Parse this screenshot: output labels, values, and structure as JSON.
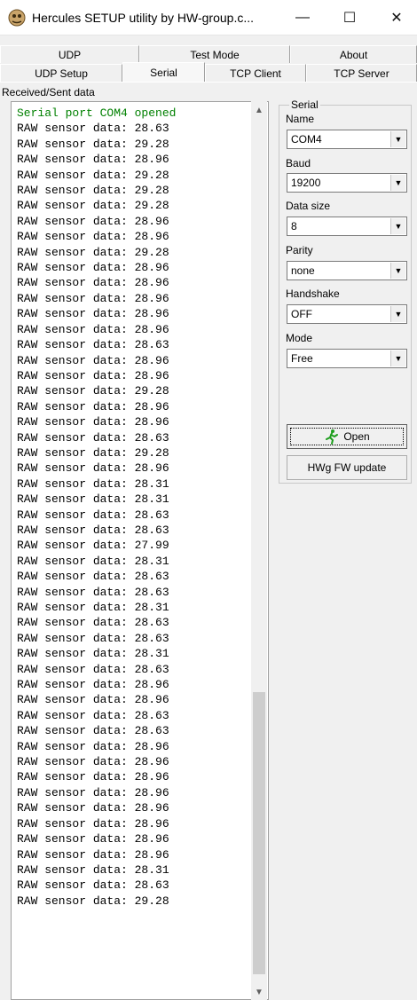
{
  "window": {
    "title": "Hercules SETUP utility by HW-group.c...",
    "minimize_glyph": "—",
    "maximize_glyph": "☐",
    "close_glyph": "✕"
  },
  "tabs": {
    "row1": [
      "UDP",
      "Test Mode",
      "About"
    ],
    "row2": [
      "UDP Setup",
      "Serial",
      "TCP Client",
      "TCP Server"
    ],
    "active": "Serial"
  },
  "received_label": "Received/Sent data",
  "log": {
    "open_message": "Serial port COM4 opened",
    "prefix": "RAW sensor data: ",
    "values": [
      "28.63",
      "29.28",
      "28.96",
      "29.28",
      "29.28",
      "29.28",
      "28.96",
      "28.96",
      "29.28",
      "28.96",
      "28.96",
      "28.96",
      "28.96",
      "28.96",
      "28.63",
      "28.96",
      "28.96",
      "29.28",
      "28.96",
      "28.96",
      "28.63",
      "29.28",
      "28.96",
      "28.31",
      "28.31",
      "28.63",
      "28.63",
      "27.99",
      "28.31",
      "28.63",
      "28.63",
      "28.31",
      "28.63",
      "28.63",
      "28.31",
      "28.63",
      "28.96",
      "28.96",
      "28.63",
      "28.63",
      "28.96",
      "28.96",
      "28.96",
      "28.96",
      "28.96",
      "28.96",
      "28.96",
      "28.96",
      "28.31",
      "28.63",
      "29.28"
    ]
  },
  "serial": {
    "group_label": "Serial",
    "name_label": "Name",
    "name_value": "COM4",
    "baud_label": "Baud",
    "baud_value": "19200",
    "datasize_label": "Data size",
    "datasize_value": "8",
    "parity_label": "Parity",
    "parity_value": "none",
    "handshake_label": "Handshake",
    "handshake_value": "OFF",
    "mode_label": "Mode",
    "mode_value": "Free",
    "open_button": "Open",
    "fw_button": "HWg FW update"
  },
  "icons": {
    "app": "hercules-app-icon",
    "open": "running-man-icon",
    "dropdown": "chevron-down-icon"
  },
  "colors": {
    "open_message": "#008000",
    "run_icon": "#1e9e1e"
  }
}
